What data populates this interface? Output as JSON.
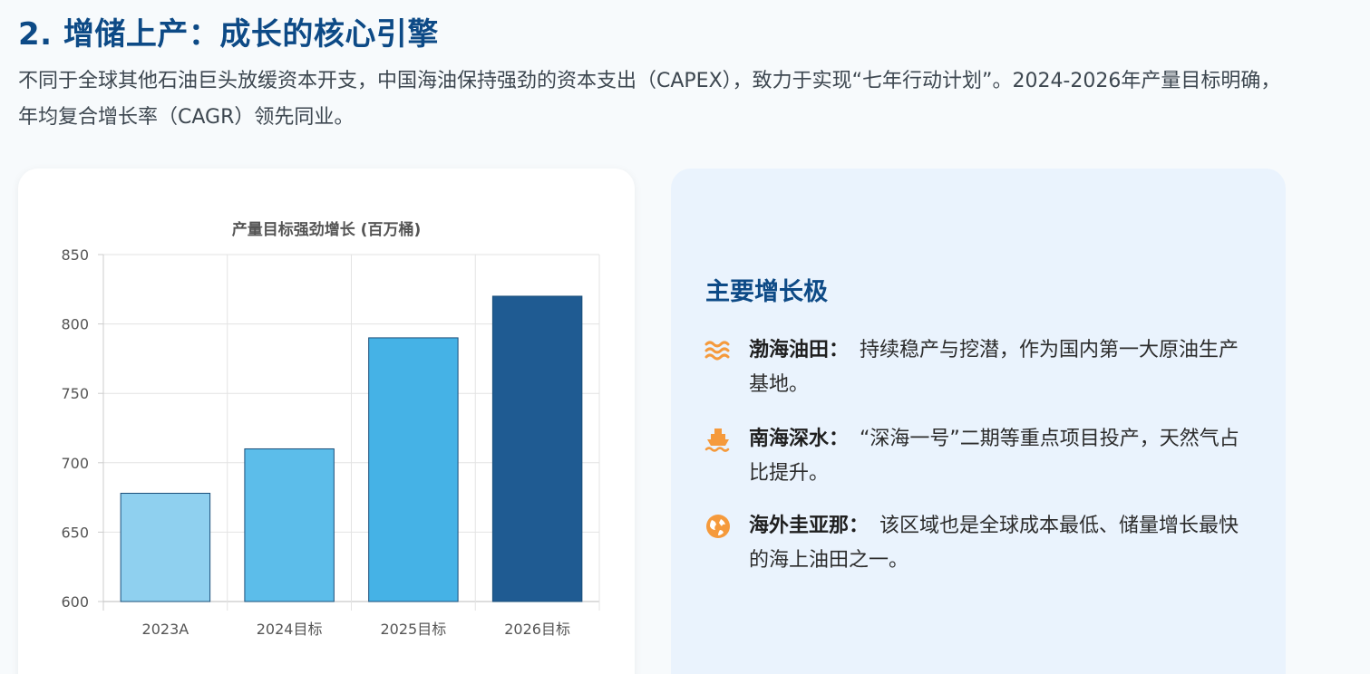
{
  "section": {
    "title": "2. 增储上产：成长的核心引擎",
    "description": "不同于全球其他石油巨头放缓资本开支，中国海油保持强劲的资本支出（CAPEX），致力于实现“七年行动计划”。2024-2026年产量目标明确，年均复合增长率（CAGR）领先同业。"
  },
  "chart_data": {
    "type": "bar",
    "title": "产量目标强劲增长 (百万桶)",
    "categories": [
      "2023A",
      "2024目标",
      "2025目标",
      "2026目标"
    ],
    "values": [
      678,
      710,
      790,
      820
    ],
    "colors": [
      "#8fd0ef",
      "#5cbdea",
      "#45b2e6",
      "#1f5b92"
    ],
    "ylim": [
      600,
      850
    ],
    "yticks": [
      600,
      650,
      700,
      750,
      800,
      850
    ],
    "grid": true,
    "xlabel": "",
    "ylabel": ""
  },
  "growth": {
    "title": "主要增长极",
    "accent_color": "#f59a3c",
    "drivers": [
      {
        "icon": "waves-icon",
        "name": "渤海油田：",
        "text": "持续稳产与挖潜，作为国内第一大原油生产基地。"
      },
      {
        "icon": "ship-icon",
        "name": "南海深水：",
        "text": "“深海一号”二期等重点项目投产，天然气占比提升。"
      },
      {
        "icon": "globe-icon",
        "name": "海外圭亚那：",
        "text": "该区域也是全球成本最低、储量增长最快的海上油田之一。"
      }
    ]
  }
}
